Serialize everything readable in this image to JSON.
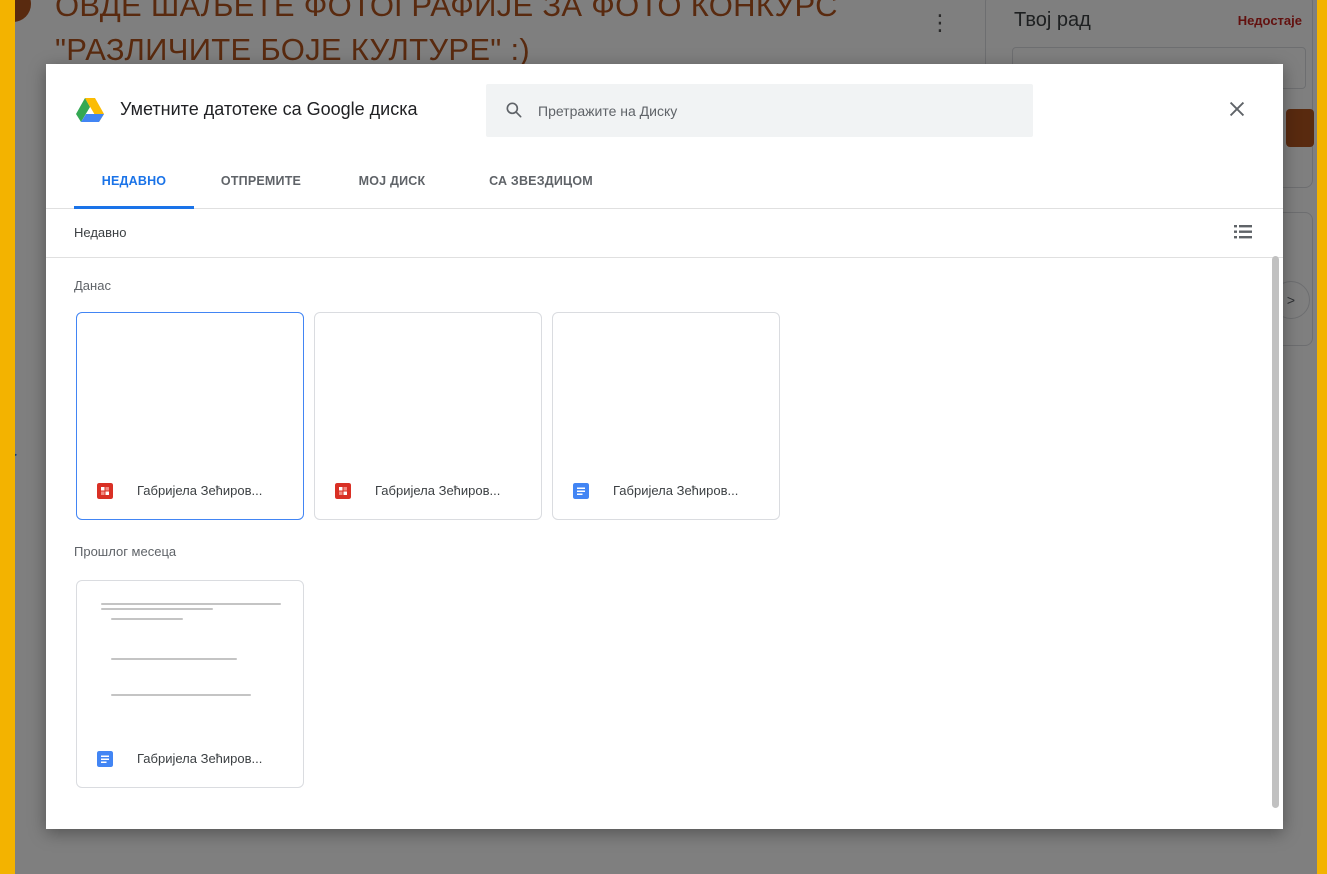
{
  "background": {
    "page_title": "ОВДЕ ШАЉЕТЕ ФОТОГРАФИЈЕ ЗА ФОТО КОНКУРС \"РАЗЛИЧИТЕ БОЈЕ КУЛТУРЕ\" :)",
    "work_panel_title": "Твој рад",
    "work_status": "Недостаје"
  },
  "dialog": {
    "title": "Уметните датотеке са Google диска",
    "search_placeholder": "Претражите на Диску",
    "tabs": [
      {
        "label": "НЕДАВНО",
        "active": true
      },
      {
        "label": "ОТПРЕМИТЕ",
        "active": false
      },
      {
        "label": "МОЈ ДИСК",
        "active": false
      },
      {
        "label": "СА ЗВЕЗДИЦОМ",
        "active": false
      }
    ],
    "breadcrumb": "Недавно",
    "sections": [
      {
        "title": "Данас",
        "files": [
          {
            "name": "Габријела Зећиров...",
            "type": "image",
            "icon": "image-file-icon",
            "selected": true
          },
          {
            "name": "Габријела Зећиров...",
            "type": "image",
            "icon": "image-file-icon",
            "selected": false
          },
          {
            "name": "Габријела Зећиров...",
            "type": "document",
            "icon": "docs-file-icon",
            "selected": false
          }
        ]
      },
      {
        "title": "Прошлог месеца",
        "files": [
          {
            "name": "Габријела Зећиров...",
            "type": "document",
            "icon": "docs-file-icon",
            "selected": false
          }
        ]
      }
    ]
  },
  "colors": {
    "accent": "#1a73e8",
    "image_icon": "#d93025",
    "docs_icon": "#4285f4",
    "frame": "#f3b300",
    "page_title": "#b3541e"
  }
}
